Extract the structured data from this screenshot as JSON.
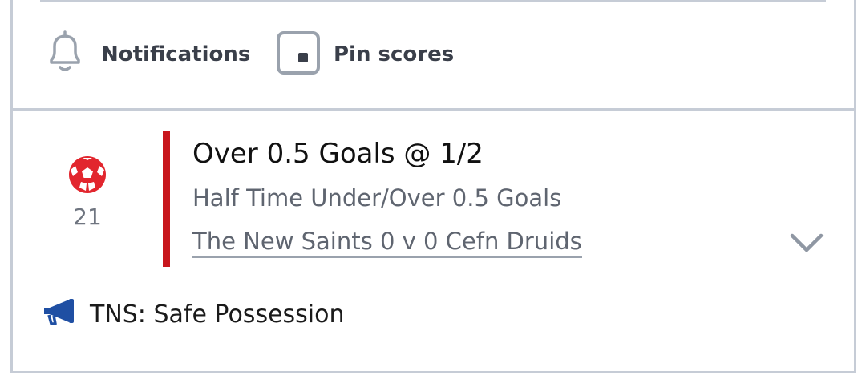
{
  "actions": {
    "notifications_label": "Notifications",
    "pin_label": "Pin scores"
  },
  "event": {
    "icon": "football-icon",
    "minute": "21"
  },
  "bet": {
    "title": "Over 0.5 Goals @ 1/2",
    "market": "Half Time Under/Over 0.5 Goals",
    "match": "The New Saints 0 v 0 Cefn Druids",
    "accent_color": "#c8161d"
  },
  "commentary": {
    "icon": "megaphone-icon",
    "text": "TNS: Safe Possession",
    "icon_color": "#1f4fa3"
  }
}
